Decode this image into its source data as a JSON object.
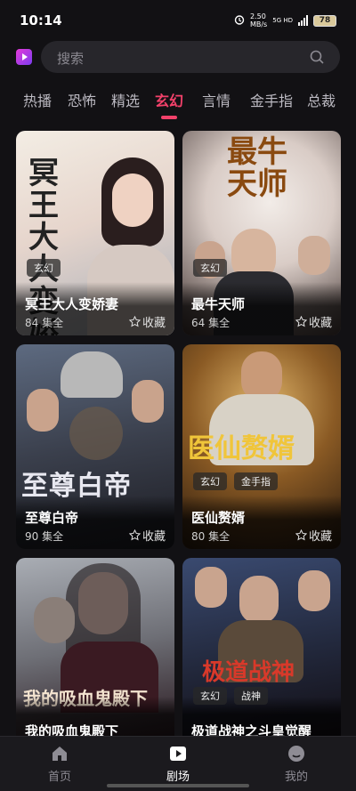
{
  "status_bar": {
    "time": "10:14",
    "net_speed_value": "2.50",
    "net_speed_unit": "MB/s",
    "network": "5G HD",
    "battery": "78"
  },
  "header": {
    "search_placeholder": "搜索"
  },
  "tabs": [
    {
      "label": "热播"
    },
    {
      "label": "恐怖"
    },
    {
      "label": "精选"
    },
    {
      "label": "玄幻"
    },
    {
      "label": "言情"
    },
    {
      "label": "金手指"
    },
    {
      "label": "总裁"
    }
  ],
  "active_tab": "玄幻",
  "cards": [
    {
      "title": "冥王大人变娇妻",
      "episodes": "84 集全",
      "fav_label": "收藏",
      "tags": [
        "玄幻"
      ],
      "poster_text": "冥王大人变娇妻"
    },
    {
      "title": "最牛天师",
      "episodes": "64 集全",
      "fav_label": "收藏",
      "tags": [
        "玄幻"
      ],
      "poster_text": "最牛天师"
    },
    {
      "title": "至尊白帝",
      "episodes": "90 集全",
      "fav_label": "收藏",
      "tags": [],
      "poster_text": "至尊白帝"
    },
    {
      "title": "医仙赘婿",
      "episodes": "80 集全",
      "fav_label": "收藏",
      "tags": [
        "玄幻",
        "金手指"
      ],
      "poster_text": "医仙赘婿"
    },
    {
      "title": "我的吸血鬼殿下",
      "episodes": "",
      "fav_label": "",
      "tags": [],
      "poster_text": "我的吸血鬼殿下"
    },
    {
      "title": "极道战神之斗皇觉醒",
      "episodes": "",
      "fav_label": "",
      "tags": [
        "玄幻",
        "战神"
      ],
      "poster_text": "极道战神"
    }
  ],
  "bottom_nav": [
    {
      "label": "首页",
      "icon": "home-icon"
    },
    {
      "label": "剧场",
      "icon": "play-icon"
    },
    {
      "label": "我的",
      "icon": "profile-icon"
    }
  ],
  "colors": {
    "accent": "#f2416a",
    "background": "#121114"
  }
}
